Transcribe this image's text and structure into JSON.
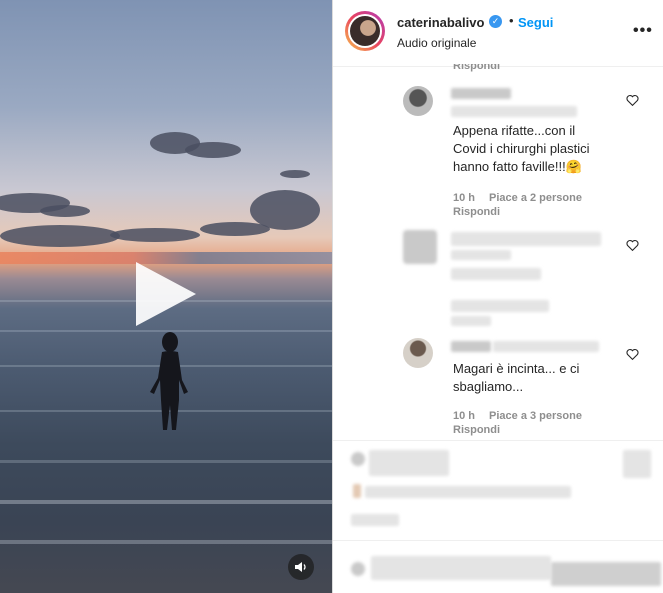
{
  "post": {
    "username": "caterinabalivo",
    "separator": "•",
    "follow_label": "Segui",
    "audio_label": "Audio originale",
    "more_label": "•••",
    "verified_icon": "verified-badge-icon"
  },
  "video": {
    "play_icon": "play-icon",
    "volume_icon": "volume-icon"
  },
  "comments": [
    {
      "partial_reply_label": "Rispondi"
    },
    {
      "text_lines": [
        "Appena rifatte...con il",
        "Covid i chirurghi plastici",
        "hanno fatto faville!!!🤗"
      ],
      "time": "10 h",
      "likes": "Piace a 2 persone",
      "reply_label": "Rispondi"
    },
    {
      "blurred": true
    },
    {
      "text_lines": [
        "Magari è incinta... e ci",
        "sbagliamo..."
      ],
      "time": "10 h",
      "likes": "Piace a 3 persone",
      "reply_label": "Rispondi"
    }
  ]
}
